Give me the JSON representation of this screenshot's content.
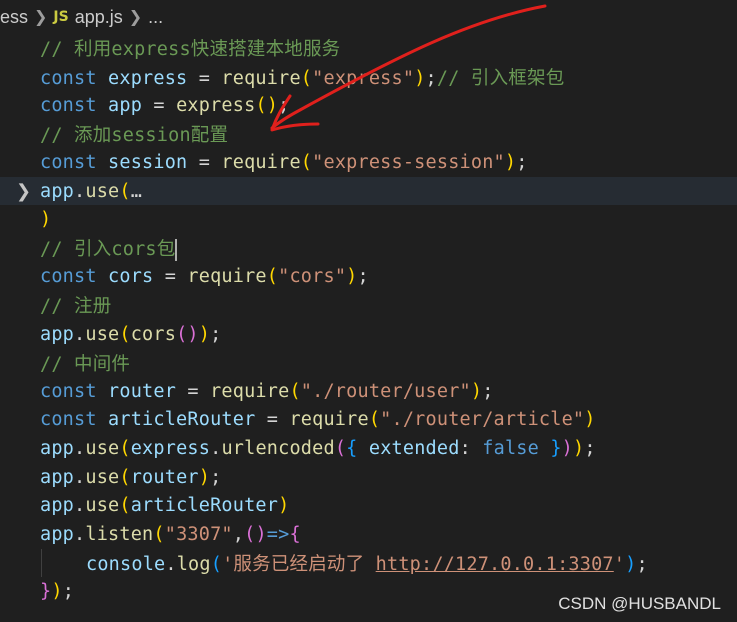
{
  "breadcrumb": {
    "folder": "ess",
    "file_badge": "JS",
    "file": "app.js",
    "ellipsis": "..."
  },
  "editor": {
    "lines": [
      {
        "id": "l1",
        "tokens": [
          {
            "c": "cm",
            "t": "// 利用express快速搭建本地服务"
          }
        ]
      },
      {
        "id": "l2",
        "tokens": [
          {
            "c": "kw",
            "t": "const "
          },
          {
            "c": "var",
            "t": "express"
          },
          {
            "c": "pn",
            "t": " = "
          },
          {
            "c": "fn",
            "t": "require"
          },
          {
            "c": "brk1",
            "t": "("
          },
          {
            "c": "str",
            "t": "\"express\""
          },
          {
            "c": "brk1",
            "t": ")"
          },
          {
            "c": "pn",
            "t": ";"
          },
          {
            "c": "cm",
            "t": "// 引入框架包"
          }
        ]
      },
      {
        "id": "l3",
        "tokens": [
          {
            "c": "kw",
            "t": "const "
          },
          {
            "c": "var",
            "t": "app"
          },
          {
            "c": "pn",
            "t": " = "
          },
          {
            "c": "fn",
            "t": "express"
          },
          {
            "c": "brk1",
            "t": "()"
          },
          {
            "c": "pn",
            "t": ";"
          }
        ]
      },
      {
        "id": "l4",
        "tokens": [
          {
            "c": "cm",
            "t": "// 添加session配置"
          }
        ]
      },
      {
        "id": "l5",
        "tokens": [
          {
            "c": "kw",
            "t": "const "
          },
          {
            "c": "var",
            "t": "session"
          },
          {
            "c": "pn",
            "t": " = "
          },
          {
            "c": "fn",
            "t": "require"
          },
          {
            "c": "brk1",
            "t": "("
          },
          {
            "c": "str",
            "t": "\"express-session\""
          },
          {
            "c": "brk1",
            "t": ")"
          },
          {
            "c": "pn",
            "t": ";"
          }
        ]
      },
      {
        "id": "l6",
        "folded": true,
        "tokens": [
          {
            "c": "var",
            "t": "app"
          },
          {
            "c": "pn",
            "t": "."
          },
          {
            "c": "fn",
            "t": "use"
          },
          {
            "c": "brk1",
            "t": "("
          },
          {
            "c": "pn",
            "t": "…"
          }
        ]
      },
      {
        "id": "l7",
        "tokens": [
          {
            "c": "brk1",
            "t": ")"
          }
        ]
      },
      {
        "id": "l8",
        "tokens": [
          {
            "c": "cm",
            "t": "// 引入cors包"
          }
        ]
      },
      {
        "id": "l9",
        "tokens": [
          {
            "c": "kw",
            "t": "const "
          },
          {
            "c": "var",
            "t": "cors"
          },
          {
            "c": "pn",
            "t": " = "
          },
          {
            "c": "fn",
            "t": "require"
          },
          {
            "c": "brk1",
            "t": "("
          },
          {
            "c": "str",
            "t": "\"cors\""
          },
          {
            "c": "brk1",
            "t": ")"
          },
          {
            "c": "pn",
            "t": ";"
          }
        ]
      },
      {
        "id": "l10",
        "tokens": [
          {
            "c": "cm",
            "t": "// 注册"
          }
        ]
      },
      {
        "id": "l11",
        "tokens": [
          {
            "c": "var",
            "t": "app"
          },
          {
            "c": "pn",
            "t": "."
          },
          {
            "c": "fn",
            "t": "use"
          },
          {
            "c": "brk1",
            "t": "("
          },
          {
            "c": "fn",
            "t": "cors"
          },
          {
            "c": "brk2",
            "t": "()"
          },
          {
            "c": "brk1",
            "t": ")"
          },
          {
            "c": "pn",
            "t": ";"
          }
        ]
      },
      {
        "id": "l12",
        "tokens": [
          {
            "c": "cm",
            "t": "// 中间件"
          }
        ]
      },
      {
        "id": "l13",
        "tokens": [
          {
            "c": "kw",
            "t": "const "
          },
          {
            "c": "var",
            "t": "router"
          },
          {
            "c": "pn",
            "t": " = "
          },
          {
            "c": "fn",
            "t": "require"
          },
          {
            "c": "brk1",
            "t": "("
          },
          {
            "c": "str",
            "t": "\"./router/user\""
          },
          {
            "c": "brk1",
            "t": ")"
          },
          {
            "c": "pn",
            "t": ";"
          }
        ]
      },
      {
        "id": "l14",
        "tokens": [
          {
            "c": "kw",
            "t": "const "
          },
          {
            "c": "var",
            "t": "articleRouter"
          },
          {
            "c": "pn",
            "t": " = "
          },
          {
            "c": "fn",
            "t": "require"
          },
          {
            "c": "brk1",
            "t": "("
          },
          {
            "c": "str",
            "t": "\"./router/article\""
          },
          {
            "c": "brk1",
            "t": ")"
          }
        ]
      },
      {
        "id": "l15",
        "tokens": [
          {
            "c": "var",
            "t": "app"
          },
          {
            "c": "pn",
            "t": "."
          },
          {
            "c": "fn",
            "t": "use"
          },
          {
            "c": "brk1",
            "t": "("
          },
          {
            "c": "var",
            "t": "express"
          },
          {
            "c": "pn",
            "t": "."
          },
          {
            "c": "fn",
            "t": "urlencoded"
          },
          {
            "c": "brk2",
            "t": "("
          },
          {
            "c": "brk3",
            "t": "{"
          },
          {
            "c": "pn",
            "t": " "
          },
          {
            "c": "var",
            "t": "extended"
          },
          {
            "c": "pn",
            "t": ": "
          },
          {
            "c": "kw",
            "t": "false"
          },
          {
            "c": "pn",
            "t": " "
          },
          {
            "c": "brk3",
            "t": "}"
          },
          {
            "c": "brk2",
            "t": ")"
          },
          {
            "c": "brk1",
            "t": ")"
          },
          {
            "c": "pn",
            "t": ";"
          }
        ]
      },
      {
        "id": "l16",
        "tokens": [
          {
            "c": "var",
            "t": "app"
          },
          {
            "c": "pn",
            "t": "."
          },
          {
            "c": "fn",
            "t": "use"
          },
          {
            "c": "brk1",
            "t": "("
          },
          {
            "c": "var",
            "t": "router"
          },
          {
            "c": "brk1",
            "t": ")"
          },
          {
            "c": "pn",
            "t": ";"
          }
        ]
      },
      {
        "id": "l17",
        "tokens": [
          {
            "c": "var",
            "t": "app"
          },
          {
            "c": "pn",
            "t": "."
          },
          {
            "c": "fn",
            "t": "use"
          },
          {
            "c": "brk1",
            "t": "("
          },
          {
            "c": "var",
            "t": "articleRouter"
          },
          {
            "c": "brk1",
            "t": ")"
          }
        ]
      },
      {
        "id": "l18",
        "tokens": [
          {
            "c": "var",
            "t": "app"
          },
          {
            "c": "pn",
            "t": "."
          },
          {
            "c": "fn",
            "t": "listen"
          },
          {
            "c": "brk1",
            "t": "("
          },
          {
            "c": "str",
            "t": "\"3307\""
          },
          {
            "c": "pn",
            "t": ","
          },
          {
            "c": "brk2",
            "t": "()"
          },
          {
            "c": "kw",
            "t": "=>"
          },
          {
            "c": "brk2",
            "t": "{"
          }
        ]
      },
      {
        "id": "l19",
        "indent": true,
        "tokens": [
          {
            "c": "var",
            "t": "console"
          },
          {
            "c": "pn",
            "t": "."
          },
          {
            "c": "fn",
            "t": "log"
          },
          {
            "c": "brk3",
            "t": "("
          },
          {
            "c": "str",
            "t": "'服务已经启动了 "
          },
          {
            "c": "str ul",
            "t": "http://127.0.0.1:3307"
          },
          {
            "c": "str",
            "t": "'"
          },
          {
            "c": "brk3",
            "t": ")"
          },
          {
            "c": "pn",
            "t": ";"
          }
        ]
      },
      {
        "id": "l20",
        "tokens": [
          {
            "c": "brk2",
            "t": "}"
          },
          {
            "c": "brk1",
            "t": ")"
          },
          {
            "c": "pn",
            "t": ";"
          }
        ]
      }
    ]
  },
  "watermark": "CSDN @HUSBANDL",
  "colors": {
    "background": "#1f1f1f",
    "annotation": "#e0201c"
  }
}
